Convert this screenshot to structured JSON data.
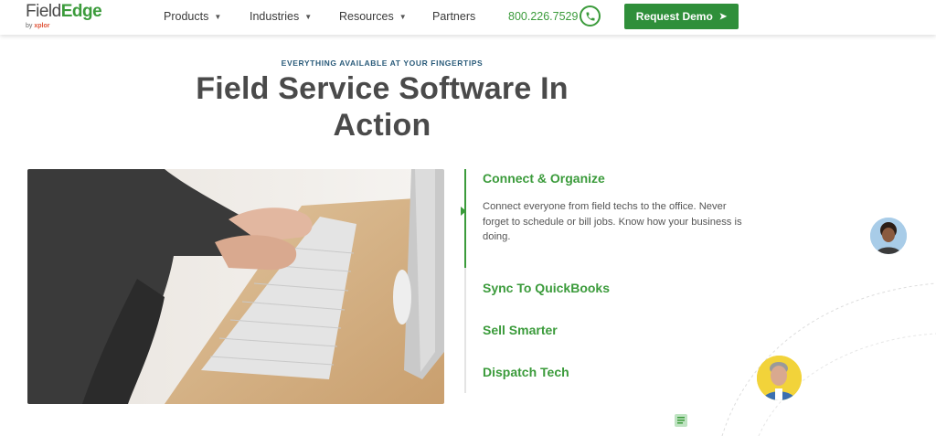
{
  "header": {
    "logo": {
      "brand_part1": "Field",
      "brand_part2": "Edge",
      "sub_prefix": "by",
      "sub_brand": "xplor"
    },
    "nav": [
      {
        "label": "Products",
        "has_menu": true
      },
      {
        "label": "Industries",
        "has_menu": true
      },
      {
        "label": "Resources",
        "has_menu": true
      },
      {
        "label": "Partners",
        "has_menu": false
      }
    ],
    "phone": "800.226.7529",
    "cta_label": "Request Demo"
  },
  "hero": {
    "eyebrow": "EVERYTHING AVAILABLE AT YOUR FINGERTIPS",
    "title": "Field Service Software In Action"
  },
  "features": {
    "items": [
      {
        "title": "Connect & Organize",
        "active": true,
        "description": "Connect everyone from field techs to the office. Never forget to schedule or bill jobs. Know how your business is doing."
      },
      {
        "title": "Sync To QuickBooks",
        "active": false
      },
      {
        "title": "Sell Smarter",
        "active": false
      },
      {
        "title": "Dispatch Tech",
        "active": false
      }
    ]
  },
  "colors": {
    "brand_green": "#3b9b3b",
    "cta_green": "#2f8f3a",
    "eyebrow_blue": "#2a5b7a",
    "title_gray": "#4a4a4a"
  },
  "icons": {
    "phone": "phone-icon",
    "cta_arrow": "arrow-right-icon",
    "nav_caret": "chevron-down-icon",
    "document": "document-icon"
  }
}
